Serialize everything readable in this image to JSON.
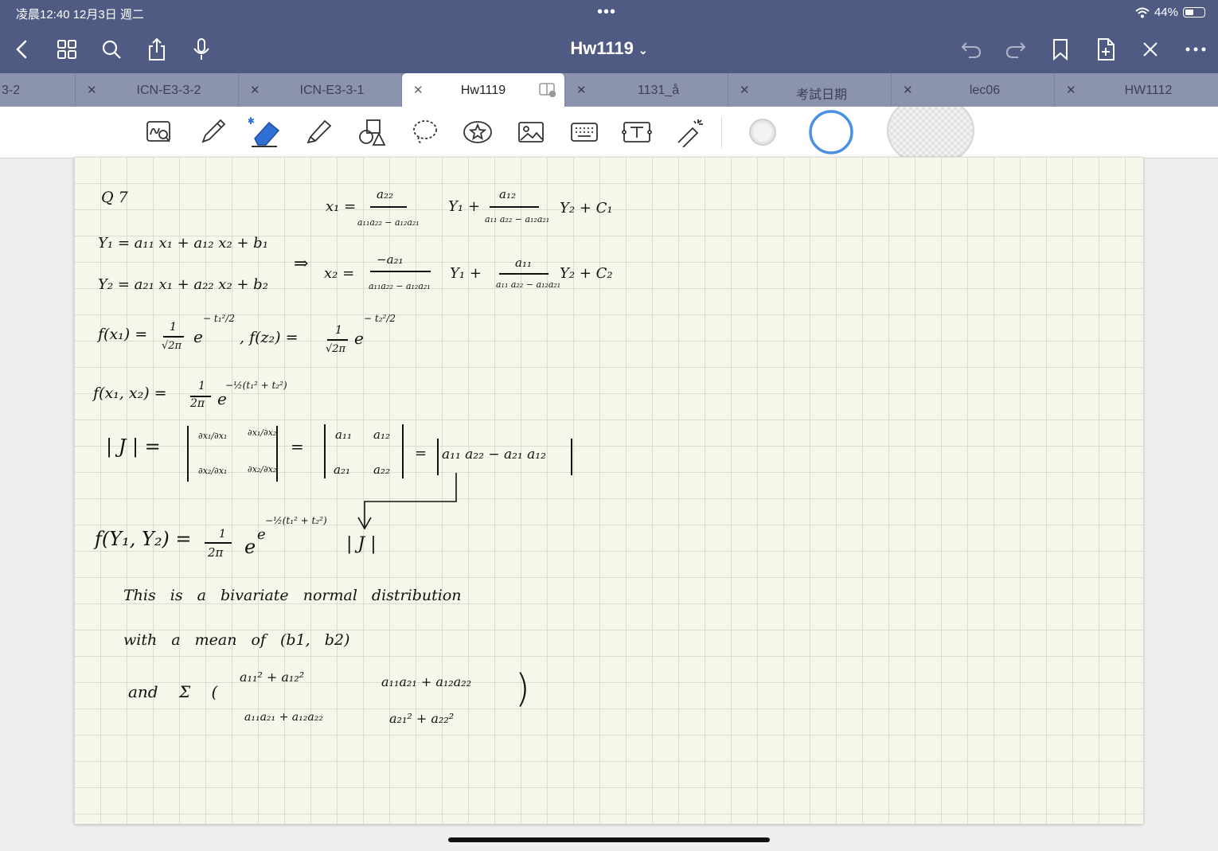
{
  "status_bar": {
    "time": "凌晨12:40 12月3日 週二",
    "dots": "•••",
    "battery": "44%",
    "battery_level": 0.44
  },
  "nav": {
    "title": "Hw1119",
    "left_icons": [
      "back-icon",
      "grid-icon",
      "search-icon",
      "share-icon",
      "microphone-icon"
    ],
    "right_icons": [
      "undo-icon",
      "redo-icon",
      "bookmark-icon",
      "add-page-icon",
      "close-pen-icon",
      "more-icon"
    ]
  },
  "tabs": [
    {
      "label": "3-2"
    },
    {
      "label": "ICN-E3-3-2"
    },
    {
      "label": "ICN-E3-3-1"
    },
    {
      "label": "Hw1119",
      "active": true
    },
    {
      "label": "1131_å"
    },
    {
      "label": "考試日期"
    },
    {
      "label": "lec06"
    },
    {
      "label": "HW1112"
    }
  ],
  "tools": [
    "handwriting-search-icon",
    "pen-icon",
    "eraser-icon",
    "highlighter-icon",
    "shapes-icon",
    "lasso-icon",
    "sticker-icon",
    "image-icon",
    "keyboard-icon",
    "text-box-icon",
    "laser-pointer-icon"
  ],
  "colors": {
    "bar_bg": "#4f5b82",
    "tab_bg": "#8c94ad",
    "paper": "#f7f6ea",
    "eraser": "#2f6fd6",
    "ring": "#4a90e2"
  },
  "notes": {
    "q": "Q 7",
    "y1": "Y₁ = a₁₁ x₁ + a₁₂ x₂ + b₁",
    "y2": "Y₂ = a₂₁ x₁ + a₂₂ x₂ + b₂",
    "arrow": "⇒",
    "x1_lhs": "x₁ =",
    "x1_n1": "a₂₂",
    "x1_d1": "a₁₁a₂₂ − a₁₂a₂₁",
    "x1_m1": "Y₁ +",
    "x1_n2": "a₁₂",
    "x1_d2": "a₁₁ a₂₂ − a₁₂a₂₁",
    "x1_m2": "Y₂  + C₁",
    "x2_lhs": "x₂ =",
    "x2_n1": "−a₂₁",
    "x2_d1": "a₁₁a₂₂ − a₁₂a₂₁",
    "x2_m1": "Y₁ +",
    "x2_n2": "a₁₁",
    "x2_d2": "a₁₁ a₂₂ − a₁₂a₂₁",
    "x2_m2": "Y₂ + C₂",
    "fx1": "f(x₁) =",
    "f_one": "1",
    "f_sqrt": "√2π",
    "fe": "e",
    "fx1_exp": "− t₁²/2",
    "fz2": ", f(z₂) =",
    "fz2_exp": "− t₂²/2",
    "fxx": "f(x₁, x₂) =",
    "two_pi": "2π",
    "fxx_exp": "−½(t₁² + t₂²)",
    "j_lhs": "| J | =",
    "j_11": "∂x₁/∂x₁",
    "j_12": "∂x₁/∂x₂",
    "j_21": "∂x₂/∂x₁",
    "j_22": "∂x₂/∂x₂",
    "eq": "=",
    "a11": "a₁₁",
    "a12": "a₁₂",
    "a21": "a₂₁",
    "a22": "a₂₂",
    "det": "a₁₁ a₂₂ − a₂₁ a₁₂",
    "fyy": "f(Y₁, Y₂) =",
    "fyy_e": "e",
    "fyy_exp": "−½(t₁² + t₂²)",
    "absj": "| J |",
    "line1": "This  is  a  bivariate  normal  distribution",
    "line2": "with  a  mean  of  (b1, b2)",
    "and_sigma": "and  Σ (",
    "s11": "a₁₁² + a₁₂²",
    "s12": "a₁₁a₂₁ + a₁₂a₂₂",
    "s21": "a₁₁a₂₁ + a₁₂a₂₂",
    "s22": "a₂₁² + a₂₂²",
    "close_paren": ")"
  }
}
